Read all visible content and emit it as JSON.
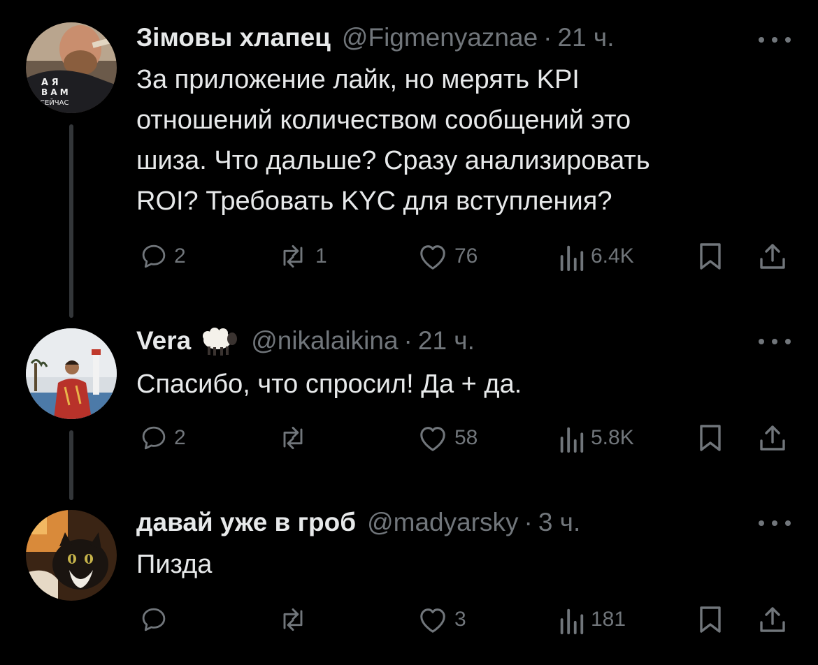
{
  "theme": {
    "background": "#000000",
    "text": "#e7e9ea",
    "muted": "#71767b",
    "thread_line": "#333639"
  },
  "tweets": [
    {
      "name": "Зімовы хлапец",
      "handle": "@Figmenyaznae",
      "dot": "·",
      "time": "21 ч.",
      "text": "За приложение лайк, но мерять KPI\nотношений количеством сообщений это\nшиза. Что дальше? Сразу анализировать\nROI? Требовать KYC для вступления?",
      "avatar_text": [
        "А  Я",
        "В А М",
        "СЕЙЧАС"
      ],
      "replies": "2",
      "reposts": "1",
      "likes": "76",
      "views": "6.4K"
    },
    {
      "name": "Vera",
      "name_emoji": "sheep-emoji",
      "handle": "@nikalaikina",
      "dot": "·",
      "time": "21 ч.",
      "text": "Спасибо, что спросил! Да + да.",
      "replies": "2",
      "reposts": "",
      "likes": "58",
      "views": "5.8K"
    },
    {
      "name": "давай уже в гроб",
      "handle": "@madyarsky",
      "dot": "·",
      "time": "3 ч.",
      "text": "Пизда",
      "replies": "",
      "reposts": "",
      "likes": "3",
      "views": "181"
    }
  ]
}
